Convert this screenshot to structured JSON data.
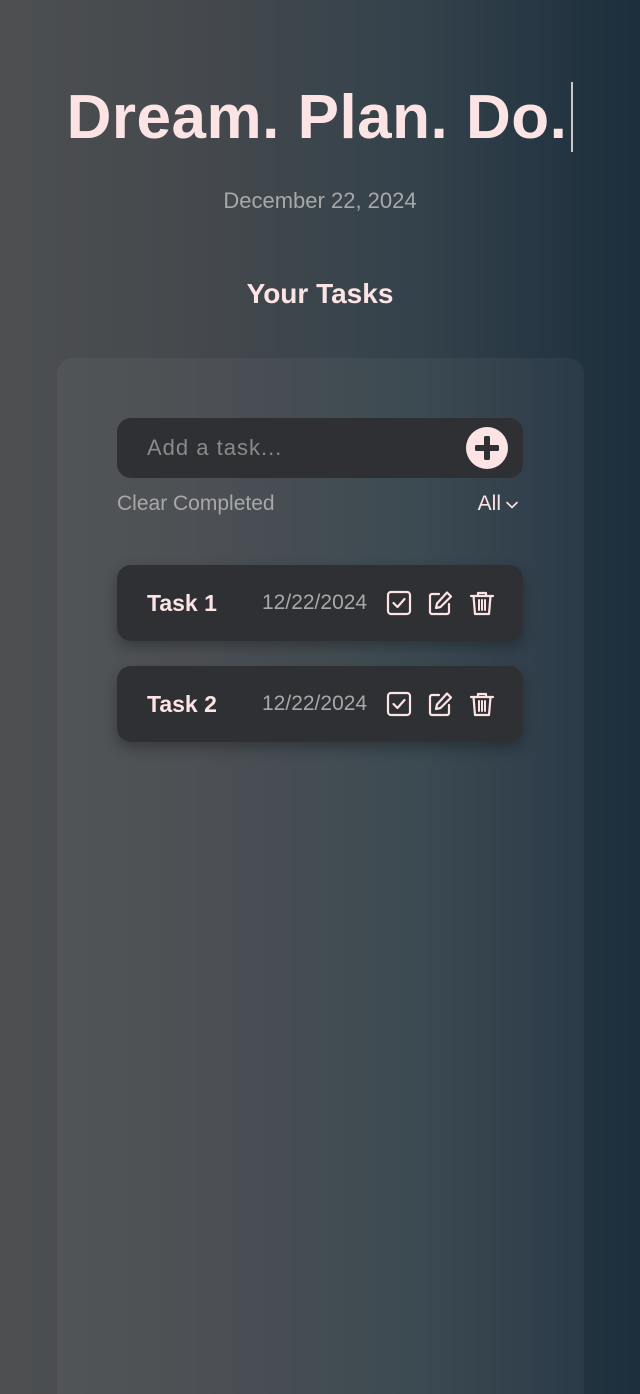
{
  "header": {
    "title": "Dream. Plan. Do.",
    "date": "December 22, 2024",
    "section_title": "Your Tasks"
  },
  "add_task": {
    "placeholder": "Add a task...",
    "value": "",
    "button_icon": "plus-circle-icon"
  },
  "controls": {
    "clear_label": "Clear Completed",
    "filter_value": "All",
    "filter_icon": "chevron-down-icon"
  },
  "tasks": [
    {
      "name": "Task 1",
      "date": "12/22/2024"
    },
    {
      "name": "Task 2",
      "date": "12/22/2024"
    }
  ],
  "task_actions": [
    "checkbox-checked-icon",
    "edit-icon",
    "trash-icon"
  ],
  "colors": {
    "accent": "#fde4e4",
    "card": "#2f3034",
    "muted_text": "#a8a8a8"
  }
}
